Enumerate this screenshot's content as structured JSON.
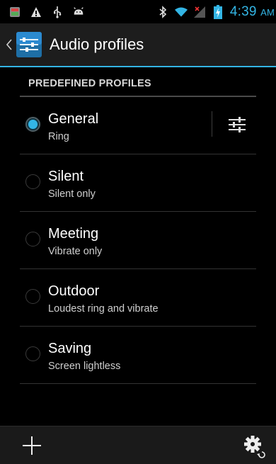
{
  "status_bar": {
    "time": "4:39",
    "ampm": "AM",
    "icons": [
      "app-notification-icon",
      "warning-icon",
      "usb-icon",
      "android-debug-icon",
      "bluetooth-icon",
      "wifi-icon",
      "signal-icon",
      "battery-charging-icon"
    ],
    "accent": "#33b5e5"
  },
  "action_bar": {
    "title": "Audio profiles",
    "icon": "audio-profiles-icon"
  },
  "section": {
    "header": "PREDEFINED PROFILES"
  },
  "profiles": [
    {
      "name": "General",
      "subtitle": "Ring",
      "selected": true
    },
    {
      "name": "Silent",
      "subtitle": "Silent only",
      "selected": false
    },
    {
      "name": "Meeting",
      "subtitle": "Vibrate only",
      "selected": false
    },
    {
      "name": "Outdoor",
      "subtitle": "Loudest ring and vibrate",
      "selected": false
    },
    {
      "name": "Saving",
      "subtitle": "Screen lightless",
      "selected": false
    }
  ],
  "bottom_bar": {
    "add_icon": "plus-icon",
    "reset_icon": "reset-settings-icon"
  },
  "colors": {
    "background": "#000000",
    "action_bar": "#1d1d1d",
    "accent": "#33b5e5"
  }
}
